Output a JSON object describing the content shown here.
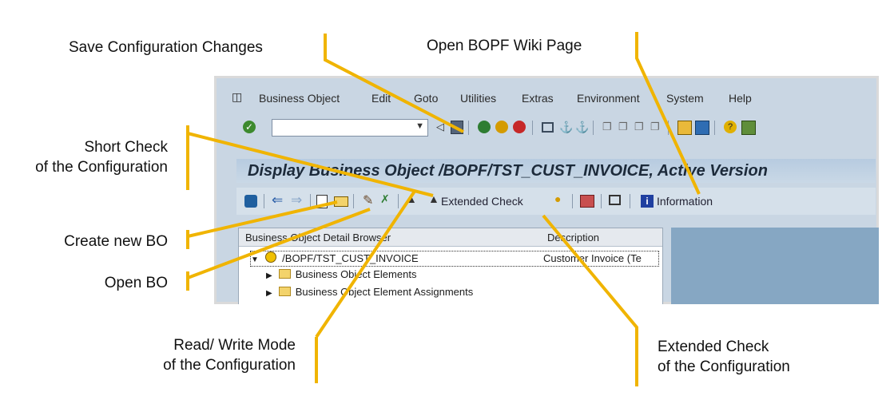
{
  "callouts": {
    "save": "Save Configuration Changes",
    "wiki": "Open BOPF Wiki Page",
    "short_check_1": "Short Check",
    "short_check_2": "of the Configuration",
    "create": "Create new BO",
    "open": "Open BO",
    "rw_1": "Read/ Write Mode",
    "rw_2": "of the Configuration",
    "ext_1": "Extended Check",
    "ext_2": "of the Configuration"
  },
  "menu": [
    "Business Object",
    "Edit",
    "Goto",
    "Utilities",
    "Extras",
    "Environment",
    "System",
    "Help"
  ],
  "title": "Display Business Object /BOPF/TST_CUST_INVOICE, Active Version",
  "toolbar": {
    "extended_check": "Extended Check",
    "information": "Information"
  },
  "tree": {
    "col1": "Business Object Detail Browser",
    "col2": "Description",
    "root": "/BOPF/TST_CUST_INVOICE",
    "root_desc": "Customer Invoice (Te",
    "child1": "Business Object Elements",
    "child2": "Business Object Element Assignments"
  },
  "colors": {
    "accent": "#f0b400",
    "sap_bg": "#c9d6e3"
  }
}
